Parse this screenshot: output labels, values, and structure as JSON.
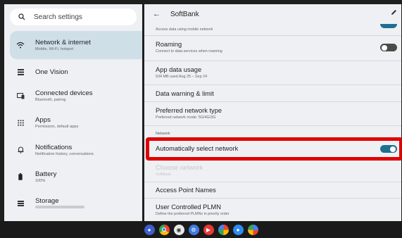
{
  "search": {
    "placeholder": "Search settings"
  },
  "sidebar": {
    "items": [
      {
        "title": "Network & internet",
        "subtitle": "Mobile, Wi-Fi, hotspot",
        "icon": "wifi-icon"
      },
      {
        "title": "One Vision",
        "subtitle": "",
        "icon": "grid-icon"
      },
      {
        "title": "Connected devices",
        "subtitle": "Bluetooth, pairing",
        "icon": "devices-icon"
      },
      {
        "title": "Apps",
        "subtitle": "Permission, default apps",
        "icon": "apps-icon"
      },
      {
        "title": "Notifications",
        "subtitle": "Notification history, conversations",
        "icon": "bell-icon"
      },
      {
        "title": "Battery",
        "subtitle": "100%",
        "icon": "battery-icon"
      },
      {
        "title": "Storage",
        "subtitle": "",
        "icon": "storage-icon"
      }
    ]
  },
  "detail": {
    "title": "SoftBank",
    "clipped_subtitle": "Access data using mobile network",
    "roaming": {
      "title": "Roaming",
      "subtitle": "Connect to data services when roaming"
    },
    "app_data_usage": {
      "title": "App data usage",
      "subtitle": "534 MB used Aug 25 – Sep 24"
    },
    "data_warning": {
      "title": "Data warning & limit"
    },
    "preferred_network": {
      "title": "Preferred network type",
      "subtitle": "Preferred network mode: 5G/4G/3G"
    },
    "section_network": "Network",
    "auto_select": {
      "title": "Automatically select network"
    },
    "choose_network": {
      "title": "Choose network",
      "subtitle": "SoftBank"
    },
    "apn": {
      "title": "Access Point Names"
    },
    "plmn": {
      "title": "User Controlled PLMN",
      "subtitle": "Define the preferred PLMNs in priority order"
    }
  },
  "toggles": {
    "mobile_data": true,
    "roaming": false,
    "auto_select": true
  },
  "colors": {
    "accent": "#1f6f91",
    "highlight": "#e00000",
    "selected_bg": "#cfdfe8"
  },
  "taskbar": {
    "apps": [
      "launcher-icon",
      "chrome-icon",
      "camera-icon",
      "settings-icon",
      "youtube-icon",
      "photos-icon",
      "play-games-icon",
      "assistant-icon"
    ]
  }
}
